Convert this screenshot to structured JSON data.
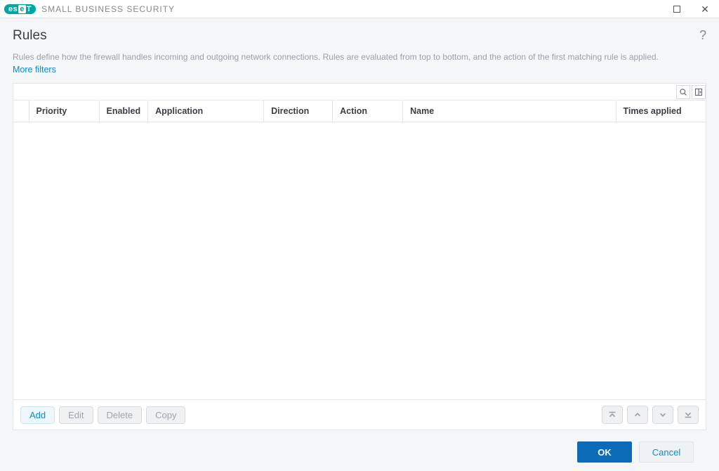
{
  "titlebar": {
    "logo_left": "es",
    "logo_mid": "e",
    "logo_right": "T",
    "product_name": "SMALL BUSINESS SECURITY"
  },
  "page": {
    "title": "Rules",
    "description": "Rules define how the firewall handles incoming and outgoing network connections. Rules are evaluated from top to bottom, and the action of the first matching rule is applied.",
    "more_filters": "More filters"
  },
  "table": {
    "search_value": "",
    "columns": {
      "priority": "Priority",
      "enabled": "Enabled",
      "application": "Application",
      "direction": "Direction",
      "action": "Action",
      "name": "Name",
      "times": "Times applied"
    },
    "rows": []
  },
  "actions": {
    "add": "Add",
    "edit": "Edit",
    "delete": "Delete",
    "copy": "Copy"
  },
  "footer": {
    "ok": "OK",
    "cancel": "Cancel"
  }
}
